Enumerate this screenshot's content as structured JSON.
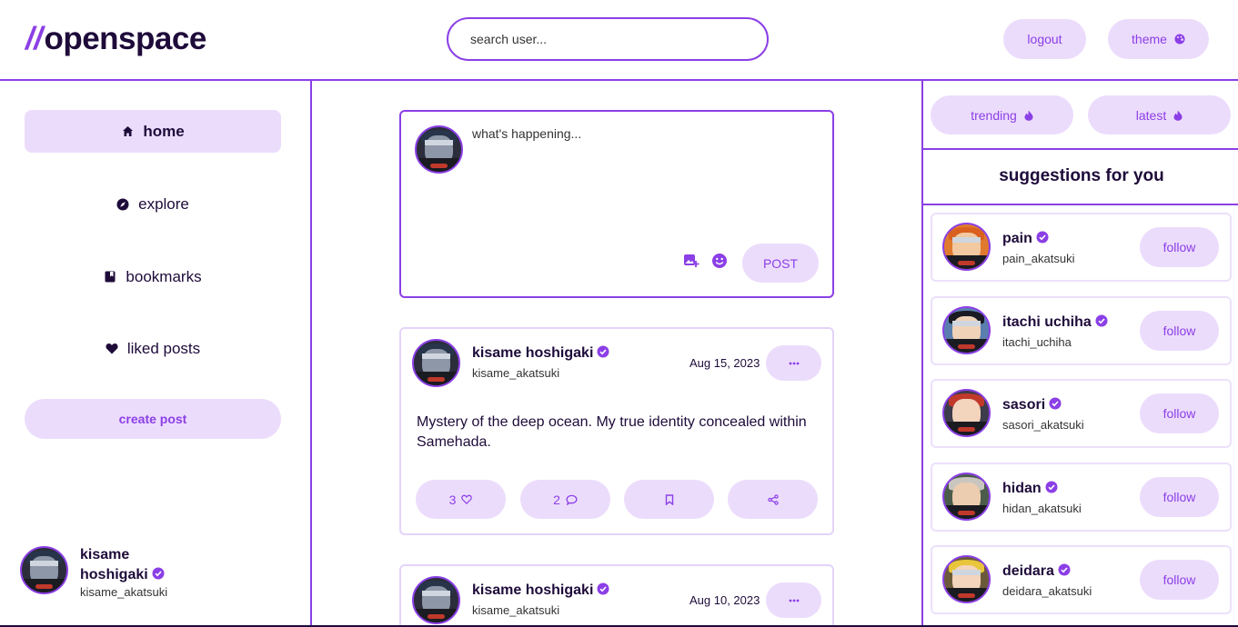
{
  "header": {
    "logo_slashes": "//",
    "logo_text": "openspace",
    "search_placeholder": "search user...",
    "logout_label": "logout",
    "theme_label": "theme"
  },
  "sidebar": {
    "items": [
      {
        "label": "home",
        "icon": "home-icon"
      },
      {
        "label": "explore",
        "icon": "compass-icon"
      },
      {
        "label": "bookmarks",
        "icon": "bookmark-icon"
      },
      {
        "label": "liked posts",
        "icon": "heart-icon"
      }
    ],
    "create_post_label": "create post",
    "profile": {
      "name": "kisame hoshigaki",
      "handle": "kisame_akatsuki"
    }
  },
  "composer": {
    "placeholder": "what's happening...",
    "post_label": "POST"
  },
  "posts": [
    {
      "name": "kisame hoshigaki",
      "handle": "kisame_akatsuki",
      "date": "Aug 15, 2023",
      "body": "Mystery of the deep ocean. My true identity concealed within Samehada.",
      "likes": "3",
      "comments": "2"
    },
    {
      "name": "kisame hoshigaki",
      "handle": "kisame_akatsuki",
      "date": "Aug 10, 2023"
    }
  ],
  "right": {
    "trending_label": "trending",
    "latest_label": "latest",
    "suggestions_title": "suggestions for you",
    "suggestions": [
      {
        "name": "pain",
        "handle": "pain_akatsuki",
        "follow": "follow"
      },
      {
        "name": "itachi uchiha",
        "handle": "itachi_uchiha",
        "follow": "follow"
      },
      {
        "name": "sasori",
        "handle": "sasori_akatsuki",
        "follow": "follow"
      },
      {
        "name": "hidan",
        "handle": "hidan_akatsuki",
        "follow": "follow"
      },
      {
        "name": "deidara",
        "handle": "deidara_akatsuki",
        "follow": "follow"
      }
    ]
  },
  "colors": {
    "accent": "#8b3fe6",
    "accent_light": "#ecdcfc",
    "text": "#1e0b3a"
  }
}
